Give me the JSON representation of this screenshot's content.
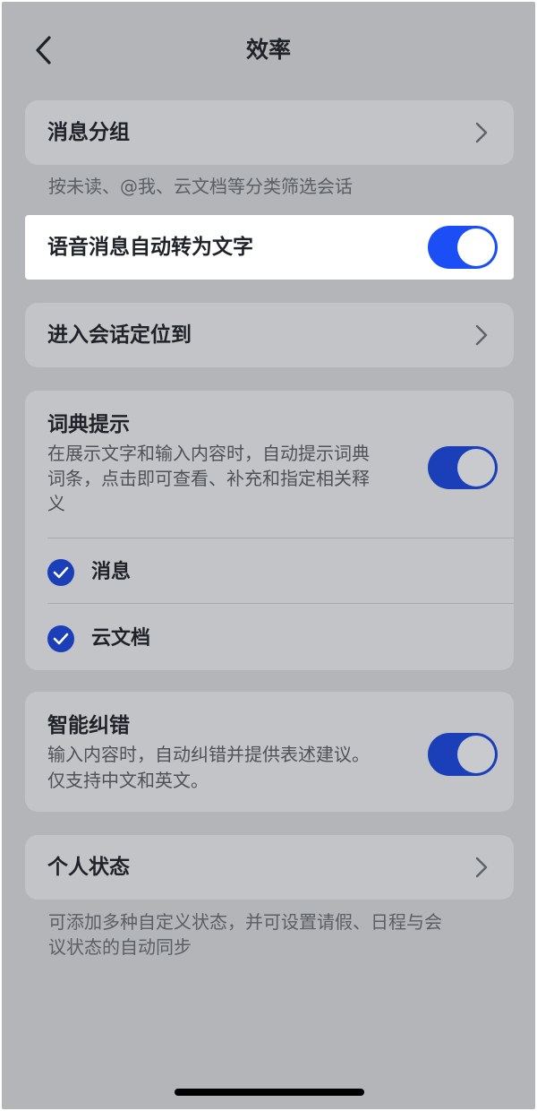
{
  "header": {
    "title": "效率"
  },
  "message_group": {
    "label": "消息分组",
    "note": "按未读、@我、云文档等分类筛选会话"
  },
  "voice_to_text": {
    "label": "语音消息自动转为文字",
    "enabled": true
  },
  "session_locate": {
    "label": "进入会话定位到"
  },
  "dictionary": {
    "label": "词典提示",
    "desc_line1": "在展示文字和输入内容时，自动提示词典",
    "desc_line2": "词条，点击即可查看、补充和指定相关释",
    "desc_line3": "义",
    "enabled": true,
    "options": [
      {
        "label": "消息",
        "checked": true
      },
      {
        "label": "云文档",
        "checked": true
      }
    ]
  },
  "smart_correction": {
    "label": "智能纠错",
    "desc_line1": "输入内容时，自动纠错并提供表述建议。",
    "desc_line2": "仅支持中文和英文。",
    "enabled": true
  },
  "personal_status": {
    "label": "个人状态",
    "note_line1": "可添加多种自定义状态，并可设置请假、日程与会",
    "note_line2": "议状态的自动同步"
  },
  "colors": {
    "toggle_on": "#1b4ef5",
    "toggle_on_dimmed": "#1a3fb8",
    "overlay": "#b4b5b8"
  }
}
